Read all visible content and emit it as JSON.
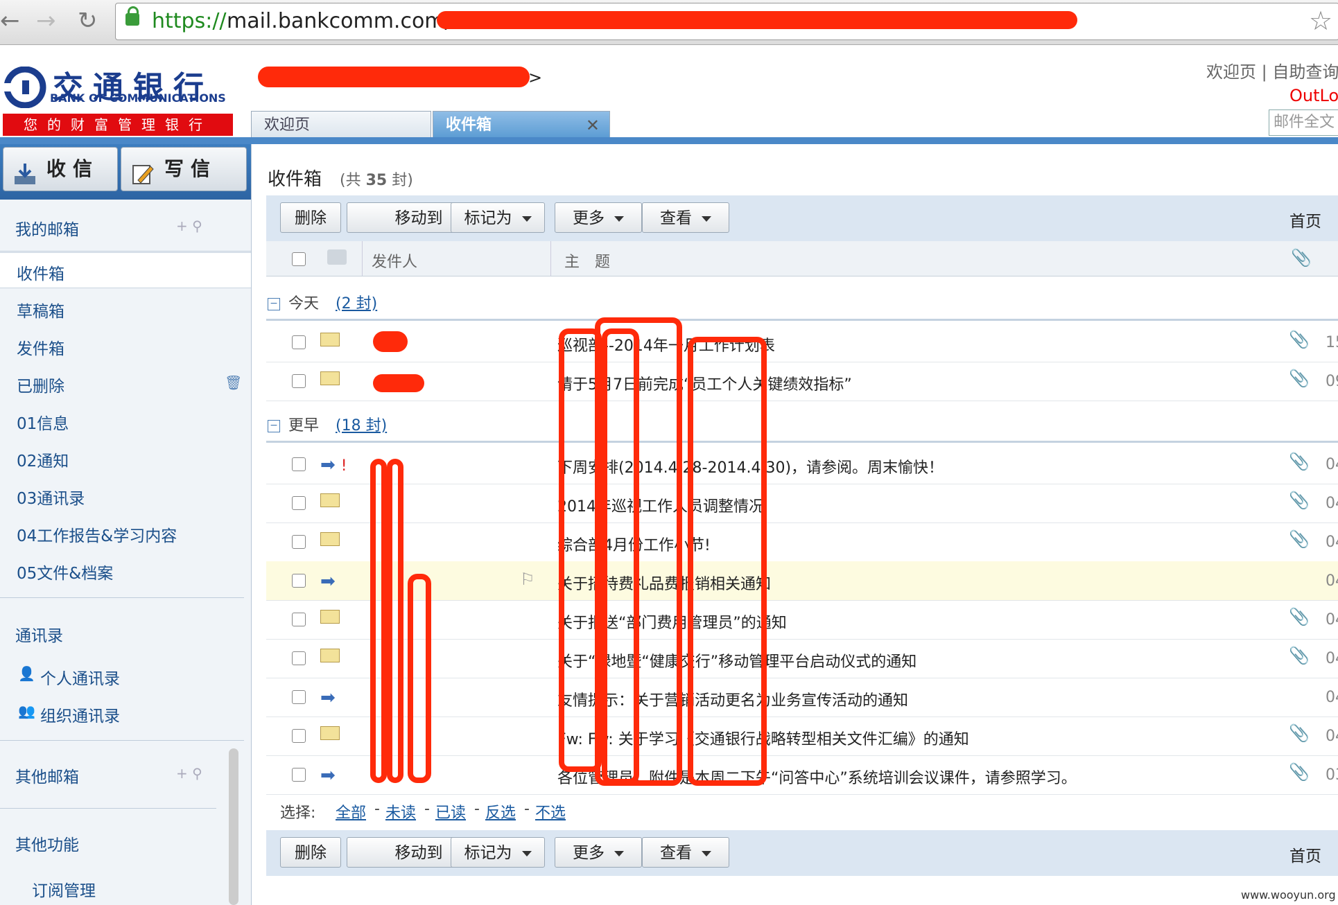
{
  "browser": {
    "url_protocol": "https://",
    "url_host": "mail.bankcomm.com/",
    "back_icon": "back-arrow-icon",
    "forward_icon": "forward-arrow-icon",
    "reload_icon": "reload-icon",
    "star_icon": "star-icon"
  },
  "header": {
    "logo_cn": "交通银行",
    "logo_en": "BANK OF COMMUNICATIONS",
    "slogan": "您的财富管理银行",
    "top_links": "欢迎页 | 自助查询",
    "outlook": "OutLo",
    "search_placeholder": "邮件全文",
    "tabs": [
      {
        "label": "欢迎页"
      },
      {
        "label": "收件箱",
        "close": "✕"
      }
    ]
  },
  "sidebar": {
    "receive_button": "收信",
    "compose_button": "写信",
    "my_mailbox": "我的邮箱",
    "folders": [
      "收件箱",
      "草稿箱",
      "发件箱",
      "已删除",
      "01信息",
      "02通知",
      "03通讯录",
      "04工作报告&学习内容",
      "05文件&档案"
    ],
    "contacts_head": "通讯录",
    "contacts": [
      "个人通讯录",
      "组织通讯录"
    ],
    "other_mailbox": "其他邮箱",
    "other_functions": "其他功能",
    "subscription": "订阅管理"
  },
  "main": {
    "title": "收件箱",
    "count_prefix": "(共",
    "count": "35",
    "count_suffix": "封)",
    "toolbar": {
      "delete": "删除",
      "move_to": "移动到",
      "mark_as": "标记为",
      "more": "更多",
      "view": "查看",
      "first_page": "首页"
    },
    "columns": {
      "sender": "发件人",
      "subject": "主　题"
    },
    "groups": [
      {
        "label": "今天",
        "count": "(2 封)"
      },
      {
        "label": "更早",
        "count": "(18 封)"
      }
    ],
    "today_rows": [
      {
        "subject": "巡视部--2014年一月工作计划表",
        "date": "15"
      },
      {
        "subject": "请于5月7日前完成“员工个人关键绩效指标”",
        "date": "09"
      }
    ],
    "earlier_rows": [
      {
        "subject": "下周安排(2014.4.28-2014.4.30)，请参阅。周末愉快！",
        "date": "04"
      },
      {
        "subject": "2014年巡视工作人员调整情况",
        "date": "04"
      },
      {
        "subject": "综合部4月份工作小节!",
        "date": "04"
      },
      {
        "subject": "关于招待费礼品费报销相关通知",
        "date": "04"
      },
      {
        "subject": "关于报送“部门费用管理员”的通知",
        "date": "04"
      },
      {
        "subject": "关于“绿地暨“健康交行”移动管理平台启动仪式的通知",
        "date": "04"
      },
      {
        "subject": "友情提示：关于营销活动更名为业务宣传活动的通知",
        "date": "04"
      },
      {
        "subject": "Fw: Fw: 关于学习《交通银行战略转型相关文件汇编》的通知",
        "date": "04"
      },
      {
        "subject": "各位管理员，附件是本周二下午“问答中心”系统培训会议课件，请参照学习。",
        "date": "03"
      }
    ],
    "select": {
      "label": "选择:",
      "all": "全部",
      "unread": "未读",
      "read": "已读",
      "invert": "反选",
      "none": "不选"
    }
  },
  "watermark": "www.wooyun.org",
  "colors": {
    "accent": "#4a88c8",
    "redaction": "#ff2a0a",
    "bank_red": "#e10b10",
    "bank_blue": "#1b3d8e"
  }
}
